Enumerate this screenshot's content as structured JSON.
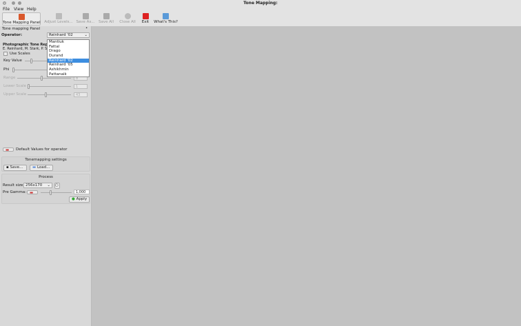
{
  "window": {
    "title": "Tone Mapping:"
  },
  "menu": [
    "File",
    "View",
    "Help"
  ],
  "toolbar": [
    {
      "label": "Tone Mapping Panel",
      "enabled": true,
      "icon": "tone-mapping-icon"
    },
    {
      "label": "Adjust Levels...",
      "enabled": false,
      "icon": "levels-icon"
    },
    {
      "label": "Save As...",
      "enabled": false,
      "icon": "save-icon"
    },
    {
      "label": "Save All",
      "enabled": false,
      "icon": "save-all-icon"
    },
    {
      "label": "Close All",
      "enabled": false,
      "icon": "close-all-icon"
    },
    {
      "label": "Exit",
      "enabled": true,
      "icon": "exit-icon"
    },
    {
      "label": "What's This?",
      "enabled": true,
      "icon": "whats-this-icon"
    }
  ],
  "panel": {
    "title": "Tone mapping Panel",
    "operator_label": "Operator:",
    "operator_value": "Reinhard '02",
    "operators": [
      "Mantiuk",
      "Fattal",
      "Drago",
      "Durand",
      "Reinhard '02",
      "Reinhard '05",
      "Ashikhmin",
      "Pattanaik"
    ],
    "desc_title": "Photographic Tone Reproduc",
    "desc_authors": "E. Reinhard, M. Stark, P. Shirle",
    "use_scales": "Use Scales",
    "key_value": "Key Value",
    "phi": "Phi",
    "range": "Range",
    "range_val": "8",
    "lower_scale": "Lower Scale",
    "lower_val": "1",
    "upper_scale": "Upper Scale",
    "upper_val": "43",
    "defaults": "Default Values for operator",
    "settings_title": "Tonemapping settings",
    "save": "Save...",
    "load": "Load...",
    "process_title": "Process",
    "result_size_label": "Result size:",
    "result_size": "256x170",
    "pre_gamma_label": "Pre Gamma:",
    "pre_gamma": "1,000",
    "apply": "Apply"
  }
}
